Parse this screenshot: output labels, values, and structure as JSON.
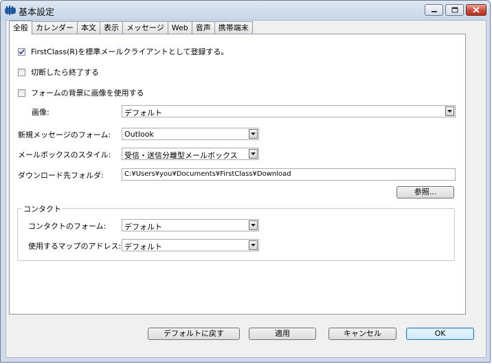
{
  "window": {
    "title": "基本設定"
  },
  "tabs": [
    {
      "label": "全般",
      "active": true
    },
    {
      "label": "カレンダー"
    },
    {
      "label": "本文"
    },
    {
      "label": "表示"
    },
    {
      "label": "メッセージ"
    },
    {
      "label": "Web"
    },
    {
      "label": "音声"
    },
    {
      "label": "携帯端末"
    }
  ],
  "general": {
    "default_client": {
      "label": "FirstClass(R)を標準メールクライアントとして登録する。",
      "checked": true
    },
    "exit_on_disconnect": {
      "label": "切断したら終了する",
      "checked": false
    },
    "form_background_image": {
      "label": "フォームの背景に画像を使用する",
      "checked": false
    },
    "image": {
      "label": "画像:",
      "value": "デフォルト"
    },
    "new_message_form": {
      "label": "新規メッセージのフォーム:",
      "value": "Outlook"
    },
    "mailbox_style": {
      "label": "メールボックスのスタイル:",
      "value": "受信・送信分離型メールボックス"
    },
    "download_folder": {
      "label": "ダウンロード先フォルダ:",
      "value": "C:¥Users¥you¥Documents¥FirstClass¥Download"
    },
    "browse_button": "参照..."
  },
  "contact": {
    "group_title": "コンタクト",
    "contact_form": {
      "label": "コンタクトのフォーム:",
      "value": "デフォルト"
    },
    "map_address": {
      "label": "使用するマップのアドレス:",
      "value": "デフォルト"
    }
  },
  "footer": {
    "restore_defaults": "デフォルトに戻す",
    "apply": "適用",
    "cancel": "キャンセル",
    "ok": "OK"
  }
}
